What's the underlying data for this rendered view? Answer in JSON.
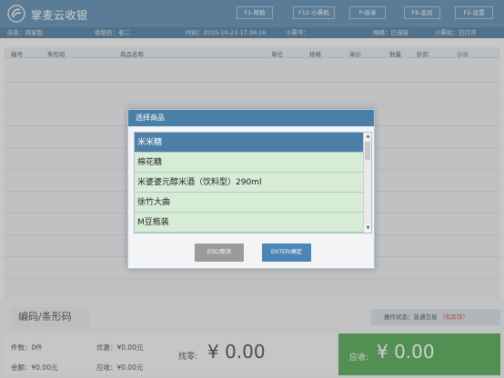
{
  "app": {
    "title": "掌麦云收银",
    "logo_icon": "logo-icon"
  },
  "toolbar": [
    {
      "label": "F1-帮助"
    },
    {
      "label": "F12-小票机"
    },
    {
      "label": "P-挂单"
    },
    {
      "label": "F8-会员"
    },
    {
      "label": "F2-设置"
    }
  ],
  "infobar": {
    "store": "店名：商家版",
    "cashier": "收银员：老二",
    "time": "时间：2015-10-23 17:36:16",
    "ticket": "小票号：",
    "network": "网络：已连接",
    "printer": "小票机：已打开"
  },
  "table": {
    "columns": [
      "编号",
      "条形码",
      "商品名称",
      "单位",
      "规格",
      "单价",
      "数量",
      "折扣",
      "小计"
    ]
  },
  "bottom": {
    "barcode_label": "编码/条形码",
    "op_status_label": "操作状态：普通交易",
    "op_status_flag": "（有库存）",
    "count": "件数：0件",
    "discount": "优惠：¥0.00元",
    "amount": "金额：¥0.00元",
    "received": "应收：¥0.00元",
    "change_label": "找零:",
    "change_value": "¥ 0.00",
    "due_label": "应收:",
    "due_value": "¥ 0.00",
    "due_color": "#3e9b3e"
  },
  "modal": {
    "title": "选择商品",
    "items": [
      {
        "label": "米米糖"
      },
      {
        "label": "棉花糖"
      },
      {
        "label": "米婆婆元醇米酒（饮料型）290ml"
      },
      {
        "label": "徐竹大曲"
      },
      {
        "label": "M豆瓶装"
      }
    ],
    "selected_index": 0,
    "cancel_label": "ESC/取消",
    "ok_label": "ENTER/确定"
  },
  "colors": {
    "accent": "#4a7fa6",
    "list_item": "#d7ecd7",
    "selected": "#4d7fa7"
  }
}
